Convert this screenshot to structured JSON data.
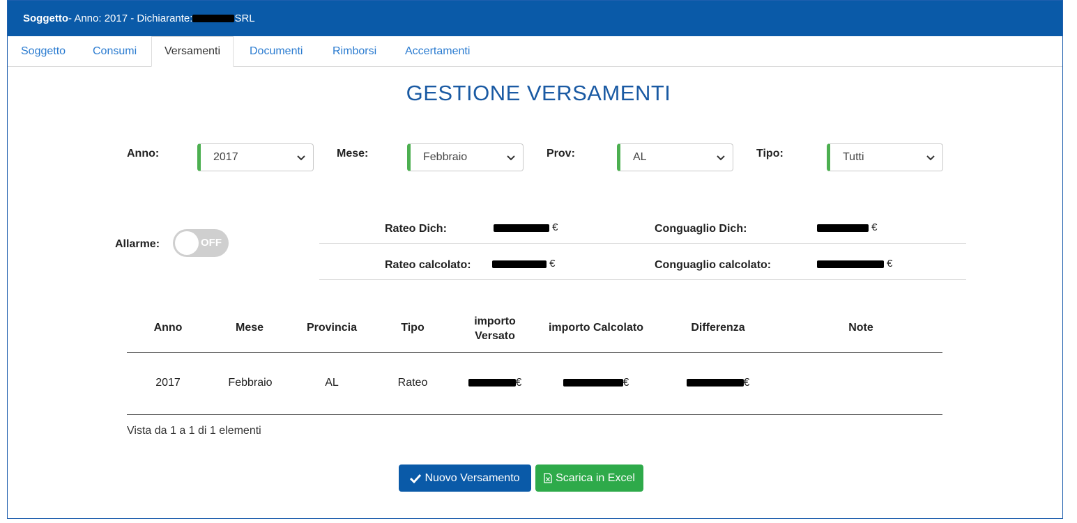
{
  "header": {
    "subject": "Soggetto",
    "info": " - Anno: 2017 - Dichiarante: ",
    "suffix": "SRL"
  },
  "tabs": [
    {
      "label": "Soggetto"
    },
    {
      "label": "Consumi"
    },
    {
      "label": "Versamenti"
    },
    {
      "label": "Documenti"
    },
    {
      "label": "Rimborsi"
    },
    {
      "label": "Accertamenti"
    }
  ],
  "active_tab": "Versamenti",
  "title": "GESTIONE VERSAMENTI",
  "filters": {
    "anno": {
      "label": "Anno:",
      "value": "2017"
    },
    "mese": {
      "label": "Mese:",
      "value": "Febbraio"
    },
    "prov": {
      "label": "Prov:",
      "value": "AL"
    },
    "tipo": {
      "label": "Tipo:",
      "value": "Tutti"
    }
  },
  "allarme": {
    "label": "Allarme:",
    "state": "OFF"
  },
  "summary": {
    "rateo_dich": {
      "label": "Rateo Dich:",
      "currency": "€"
    },
    "conguaglio_dich": {
      "label": "Conguaglio Dich:",
      "currency": "€"
    },
    "rateo_calc": {
      "label": "Rateo calcolato:",
      "currency": "€"
    },
    "conguaglio_calc": {
      "label": "Conguaglio calcolato:",
      "currency": "€"
    }
  },
  "table": {
    "headers": {
      "anno": "Anno",
      "mese": "Mese",
      "provincia": "Provincia",
      "tipo": "Tipo",
      "importo_versato_1": "importo",
      "importo_versato_2": "Versato",
      "importo_calcolato": "importo Calcolato",
      "differenza": "Differenza",
      "note": "Note"
    },
    "rows": [
      {
        "anno": "2017",
        "mese": "Febbraio",
        "provincia": "AL",
        "tipo": "Rateo",
        "currency": "€",
        "note": ""
      }
    ]
  },
  "info": "Vista da 1 a 1 di 1 elementi",
  "buttons": {
    "nuovo": "Nuovo Versamento",
    "excel": "Scarica in Excel"
  },
  "colors": {
    "primary": "#0a5aa8",
    "success": "#2eaa4a",
    "select_accent": "#4caf50"
  }
}
